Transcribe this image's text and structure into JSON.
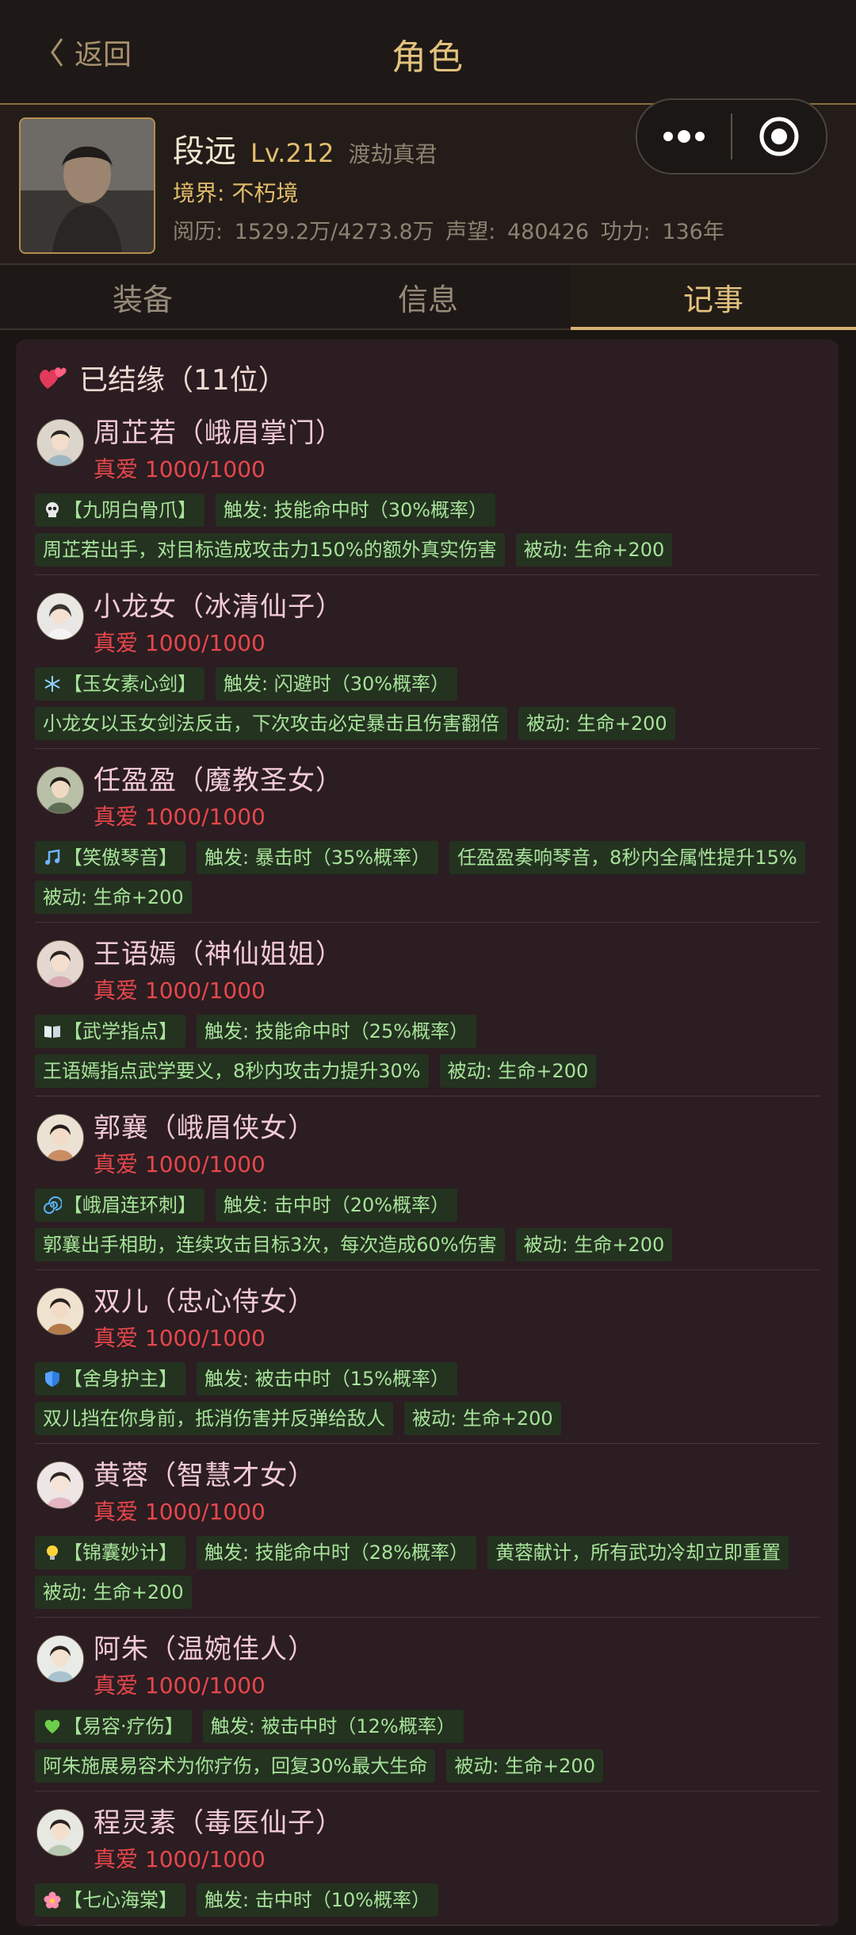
{
  "header": {
    "back_label": "返回",
    "title": "角色"
  },
  "profile": {
    "name": "段远",
    "level": "Lv.212",
    "title": "渡劫真君",
    "realm": "境界: 不朽境",
    "stats": "阅历: 1529.2万/4273.8万  声望: 480426  功力: 136年"
  },
  "tabs": [
    {
      "label": "装备"
    },
    {
      "label": "信息"
    },
    {
      "label": "记事"
    }
  ],
  "active_tab": "记事",
  "section": {
    "title": "已结缘（11位）",
    "icon": "hearts-icon"
  },
  "companions": [
    {
      "name": "周芷若（峨眉掌门）",
      "love": "真爱 1000/1000",
      "tags": [
        "【九阴白骨爪】",
        "触发: 技能命中时（30%概率）",
        "周芷若出手，对目标造成攻击力150%的额外真实伤害",
        "被动: 生命+200"
      ],
      "icon": "skull-icon"
    },
    {
      "name": "小龙女（冰清仙子）",
      "love": "真爱 1000/1000",
      "tags": [
        "【玉女素心剑】",
        "触发: 闪避时（30%概率）",
        "小龙女以玉女剑法反击，下次攻击必定暴击且伤害翻倍",
        "被动: 生命+200"
      ],
      "icon": "snowflake-icon"
    },
    {
      "name": "任盈盈（魔教圣女）",
      "love": "真爱 1000/1000",
      "tags": [
        "【笑傲琴音】",
        "触发: 暴击时（35%概率）",
        "任盈盈奏响琴音，8秒内全属性提升15%",
        "被动: 生命+200"
      ],
      "icon": "music-note-icon"
    },
    {
      "name": "王语嫣（神仙姐姐）",
      "love": "真爱 1000/1000",
      "tags": [
        "【武学指点】",
        "触发: 技能命中时（25%概率）",
        "王语嫣指点武学要义，8秒内攻击力提升30%",
        "被动: 生命+200"
      ],
      "icon": "book-icon"
    },
    {
      "name": "郭襄（峨眉侠女）",
      "love": "真爱 1000/1000",
      "tags": [
        "【峨眉连环刺】",
        "触发: 击中时（20%概率）",
        "郭襄出手相助，连续攻击目标3次，每次造成60%伤害",
        "被动: 生命+200"
      ],
      "icon": "spiral-icon"
    },
    {
      "name": "双儿（忠心侍女）",
      "love": "真爱 1000/1000",
      "tags": [
        "【舍身护主】",
        "触发: 被击中时（15%概率）",
        "双儿挡在你身前，抵消伤害并反弹给敌人",
        "被动: 生命+200"
      ],
      "icon": "shield-icon"
    },
    {
      "name": "黄蓉（智慧才女）",
      "love": "真爱 1000/1000",
      "tags": [
        "【锦囊妙计】",
        "触发: 技能命中时（28%概率）",
        "黄蓉献计，所有武功冷却立即重置",
        "被动: 生命+200"
      ],
      "icon": "lightbulb-icon"
    },
    {
      "name": "阿朱（温婉佳人）",
      "love": "真爱 1000/1000",
      "tags": [
        "【易容·疗伤】",
        "触发: 被击中时（12%概率）",
        "阿朱施展易容术为你疗伤，回复30%最大生命",
        "被动: 生命+200"
      ],
      "icon": "green-heart-icon"
    },
    {
      "name": "程灵素（毒医仙子）",
      "love": "真爱 1000/1000",
      "tags": [
        "【七心海棠】",
        "触发: 击中时（10%概率）"
      ],
      "icon": "flower-icon"
    }
  ],
  "colors": {
    "accent": "#e3c27d",
    "love": "#e6474c",
    "tag_bg": "#243220",
    "tag_text": "#a7e39a",
    "name": "#f2c9d7"
  }
}
